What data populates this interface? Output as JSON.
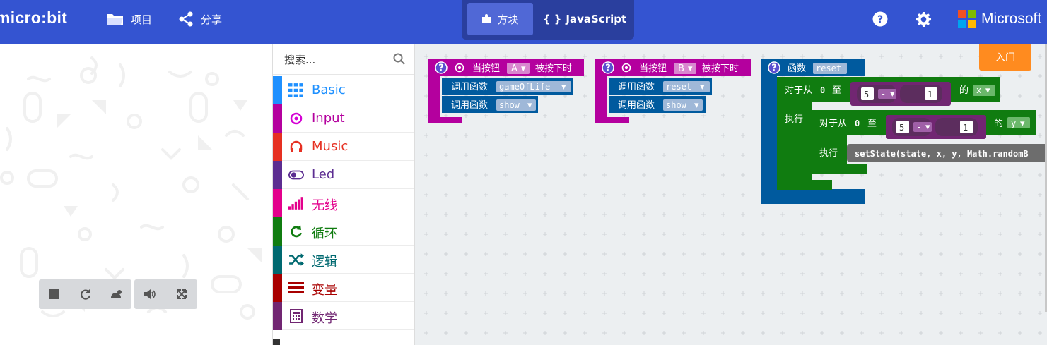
{
  "header": {
    "logo": "micro:bit",
    "projects_label": "项目",
    "share_label": "分享",
    "mode_blocks_label": "方块",
    "mode_js_label": "JavaScript",
    "mode_js_brace": "{ }",
    "brand": "Microsoft",
    "icons": [
      "folder-icon",
      "share-icon",
      "puzzle-icon",
      "help-icon",
      "gear-icon",
      "microsoft-logo"
    ]
  },
  "toolbox": {
    "search_placeholder": "搜索...",
    "categories": [
      {
        "label": "Basic",
        "color": "#1e90ff",
        "icon": "grid-icon"
      },
      {
        "label": "Input",
        "color": "#d400d4",
        "icon": "target-icon"
      },
      {
        "label": "Music",
        "color": "#e63022",
        "icon": "headphones-icon"
      },
      {
        "label": "Led",
        "color": "#5c2d91",
        "icon": "toggle-icon"
      },
      {
        "label": "无线",
        "color": "#e3008c",
        "icon": "signal-icon"
      },
      {
        "label": "循环",
        "color": "#107c10",
        "icon": "refresh-icon"
      },
      {
        "label": "逻辑",
        "color": "#006970",
        "icon": "shuffle-icon"
      },
      {
        "label": "变量",
        "color": "#a80000",
        "icon": "list-icon"
      },
      {
        "label": "数学",
        "color": "#712672",
        "icon": "calculator-icon"
      }
    ]
  },
  "workspace": {
    "get_started": "入门",
    "help_mark": "?",
    "blockA": {
      "prefix": "当按钮",
      "button": "A",
      "suffix": "被按下时",
      "call_label": "调用函数",
      "calls": [
        "gameOfLife",
        "show"
      ]
    },
    "blockB": {
      "prefix": "当按钮",
      "button": "B",
      "suffix": "被按下时",
      "call_label": "调用函数",
      "calls": [
        "reset",
        "show"
      ]
    },
    "func": {
      "label": "函数",
      "name": "reset",
      "loop_label": "对于从",
      "zero": "0",
      "to_label": "至",
      "of_label": "的",
      "do_label": "执行",
      "num": "5",
      "op": "-",
      "one": "1",
      "var_x": "x",
      "var_y": "y",
      "call": "setState(state, x, y, Math.randomB"
    }
  },
  "simulator": {
    "controls": [
      "stop-icon",
      "restart-icon",
      "slowmo-icon",
      "mute-icon",
      "fullscreen-icon"
    ]
  },
  "colors": {
    "header": "#3454d1",
    "input": "#b4009e",
    "functions": "#005a9e",
    "loops": "#107c10",
    "math": "#712672",
    "orange": "#ff8b1f"
  }
}
